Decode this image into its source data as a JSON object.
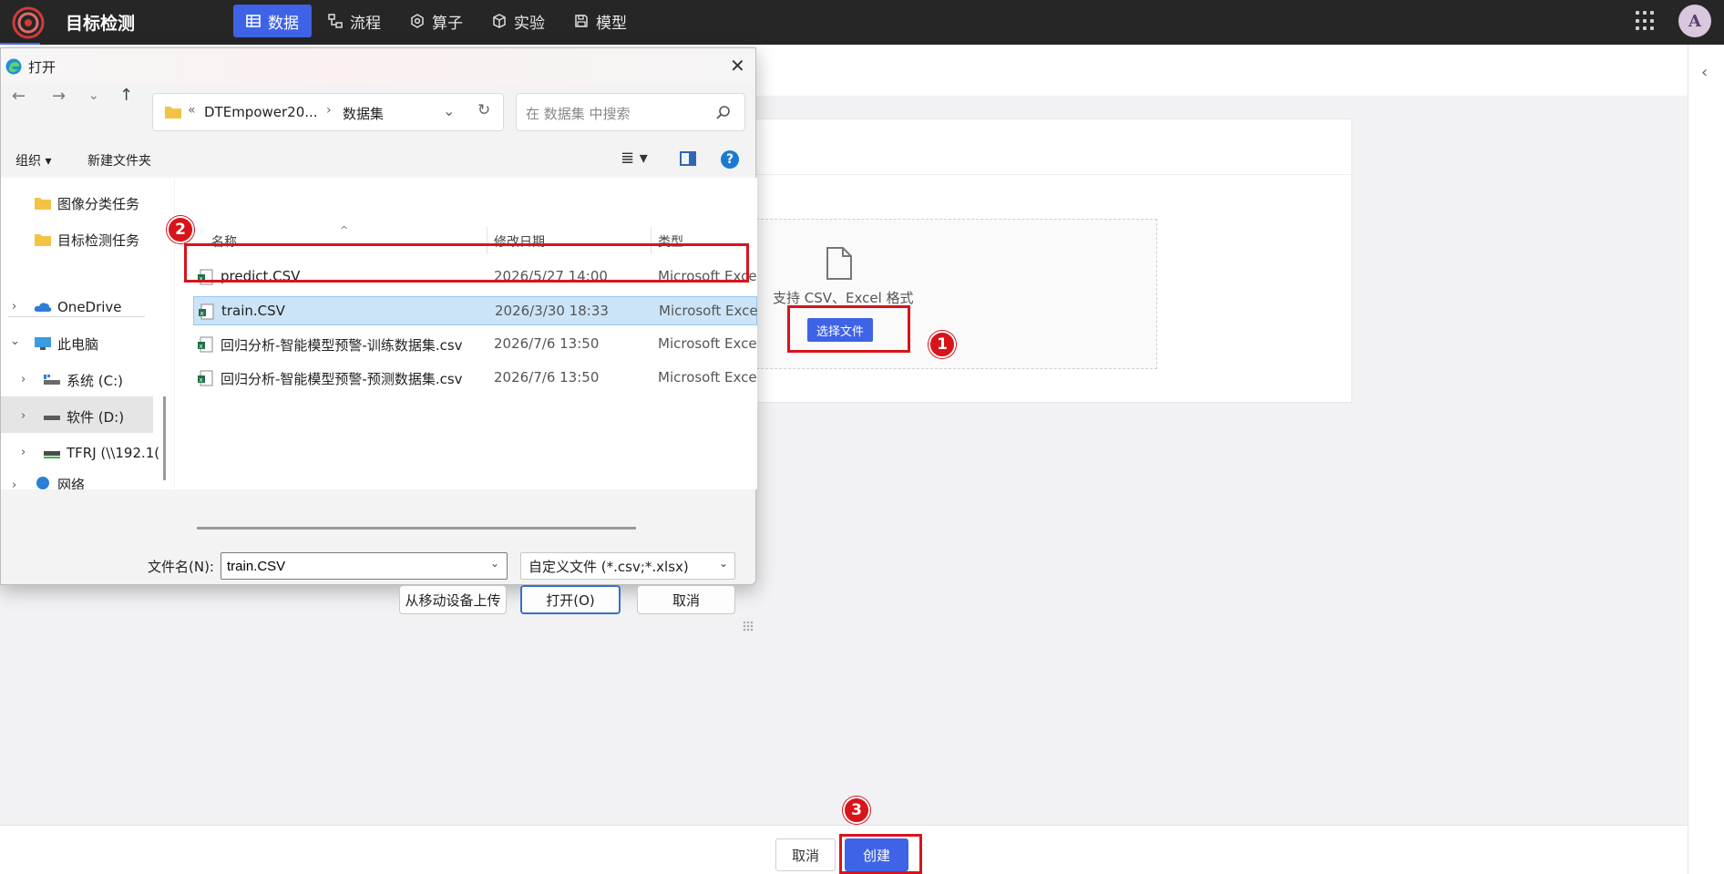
{
  "app": {
    "title": "目标检测",
    "nav": [
      {
        "label": "数据",
        "icon": "table-icon",
        "active": true
      },
      {
        "label": "流程",
        "icon": "flow-icon",
        "active": false
      },
      {
        "label": "算子",
        "icon": "operator-icon",
        "active": false
      },
      {
        "label": "实验",
        "icon": "cube-icon",
        "active": false
      },
      {
        "label": "模型",
        "icon": "save-icon",
        "active": false
      }
    ],
    "avatar_letter": "A",
    "accent_color": "#3f63e6"
  },
  "upload": {
    "support_text": "支持 CSV、Excel 格式",
    "choose_button": "选择文件"
  },
  "footer": {
    "cancel": "取消",
    "create": "创建"
  },
  "badges": [
    "1",
    "2",
    "3"
  ],
  "dialog": {
    "title": "打开",
    "address": {
      "parent": "DTEmpower20...",
      "current": "数据集",
      "chevrons": "«"
    },
    "search_placeholder": "在 数据集 中搜索",
    "toolbar": {
      "organize": "组织 ▾",
      "new_folder": "新建文件夹",
      "help": "?"
    },
    "tree": [
      {
        "label": "图像分类任务",
        "icon": "folder-icon"
      },
      {
        "label": "目标检测任务",
        "icon": "folder-icon"
      },
      {
        "label": "OneDrive",
        "icon": "cloud-icon"
      },
      {
        "label": "此电脑",
        "icon": "computer-icon"
      },
      {
        "label": "系统 (C:)",
        "icon": "drive-icon"
      },
      {
        "label": "软件 (D:)",
        "icon": "drive-icon"
      },
      {
        "label": "TFRJ (\\\\192.1(",
        "icon": "network-drive-icon"
      },
      {
        "label": "网络",
        "icon": "network-icon"
      }
    ],
    "columns": {
      "name": "名称",
      "date": "修改日期",
      "type": "类型"
    },
    "files": [
      {
        "name": "predict.CSV",
        "date": "2026/5/27 14:00",
        "type": "Microsoft Exce",
        "selected": false
      },
      {
        "name": "train.CSV",
        "date": "2026/3/30 18:33",
        "type": "Microsoft Exce",
        "selected": true
      },
      {
        "name": "回归分析-智能模型预警-训练数据集.csv",
        "date": "2026/7/6 13:50",
        "type": "Microsoft Exce",
        "selected": false
      },
      {
        "name": "回归分析-智能模型预警-预测数据集.csv",
        "date": "2026/7/6 13:50",
        "type": "Microsoft Exce",
        "selected": false
      }
    ],
    "filename_label": "文件名(N):",
    "filename_value": "train.CSV",
    "filetype": "自定义文件 (*.csv;*.xlsx)",
    "buttons": {
      "mobile_upload": "从移动设备上传",
      "open": "打开(O)",
      "cancel": "取消"
    }
  }
}
